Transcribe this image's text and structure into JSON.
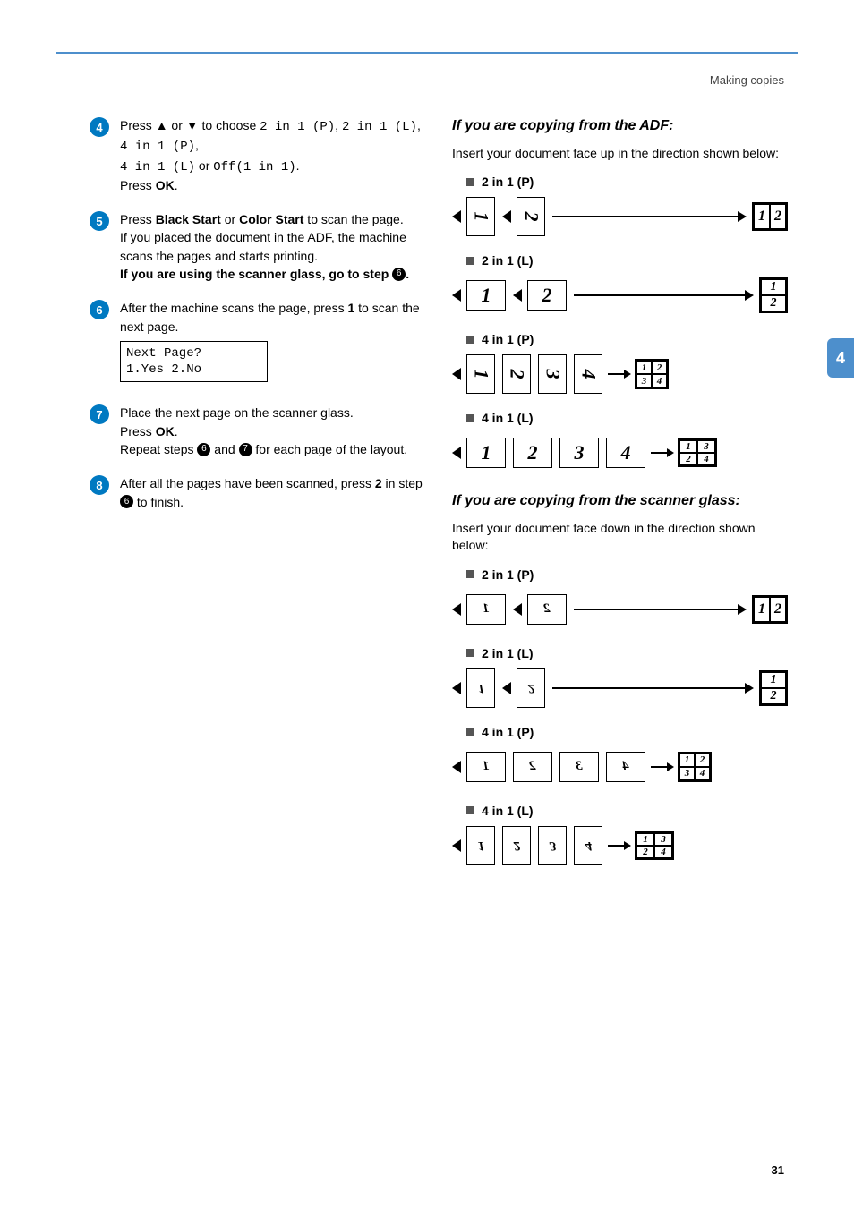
{
  "header": {
    "breadcrumb": "Making copies"
  },
  "sideTab": "4",
  "pageNumber": "31",
  "steps": {
    "s4": {
      "text_a": "Press ",
      "up": "▲",
      "or1": " or ",
      "down": "▼",
      "text_b": " to choose ",
      "opt1": "2 in 1 (P)",
      "sep1": ", ",
      "opt2": "2 in 1 (L)",
      "sep2": ", ",
      "opt3": "4 in 1 (P)",
      "sep3": ", ",
      "opt4": "4 in 1 (L)",
      "or2": " or ",
      "opt5": "Off(1 in 1)",
      "end": ".",
      "press": "Press ",
      "ok": "OK",
      "dot": "."
    },
    "s5": {
      "press": "Press ",
      "bs": "Black Start",
      "or": " or ",
      "cs": "Color Start",
      "to": " to scan the page.",
      "line2": "If you placed the document in the ADF, the machine scans the pages and starts printing.",
      "bold": "If you are using the scanner glass, go to step ",
      "ref": "6",
      "dot": "."
    },
    "s6": {
      "text": "After the machine scans the page, press ",
      "one": "1",
      "rest": " to scan the next page.",
      "lcd1": "Next Page?",
      "lcd2": "1.Yes 2.No"
    },
    "s7": {
      "l1": "Place the next page on the scanner glass.",
      "press": "Press ",
      "ok": "OK",
      "dot": ".",
      "l2a": "Repeat steps ",
      "r6": "6",
      "and": " and ",
      "r7": "7",
      "l2b": " for each page of the layout."
    },
    "s8": {
      "l1": "After all the pages have been scanned, press ",
      "two": "2",
      "in": " in step ",
      "r6": "6",
      "fin": " to finish."
    }
  },
  "adf": {
    "heading": "If you are copying from the ADF:",
    "intro": "Insert your document face up in the direction shown below:",
    "b1": "2 in 1 (P)",
    "b2": "2 in 1 (L)",
    "b3": "4 in 1 (P)",
    "b4": "4 in 1 (L)"
  },
  "glass": {
    "heading": "If you are copying from the scanner glass:",
    "intro": "Insert your document face down in the direction shown below:",
    "b1": "2 in 1 (P)",
    "b2": "2 in 1 (L)",
    "b3": "4 in 1 (P)",
    "b4": "4 in 1 (L)"
  },
  "nums": {
    "n1": "1",
    "n2": "2",
    "n3": "3",
    "n4": "4"
  }
}
